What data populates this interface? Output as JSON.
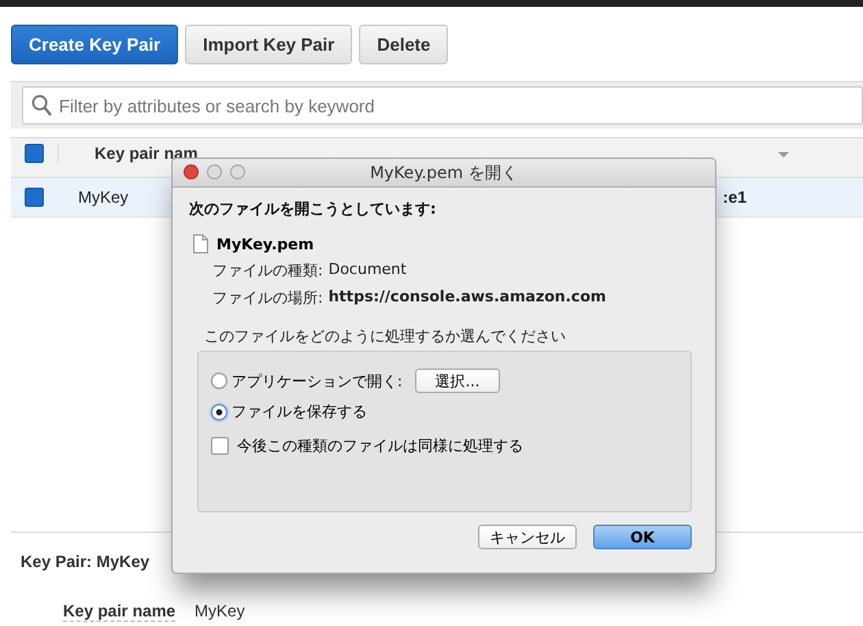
{
  "toolbar": {
    "buttons": [
      {
        "label": "Create Key Pair",
        "kind": "primary"
      },
      {
        "label": "Import Key Pair",
        "kind": "default"
      },
      {
        "label": "Delete",
        "kind": "default"
      }
    ]
  },
  "search": {
    "placeholder": "Filter by attributes or search by keyword"
  },
  "table": {
    "header_checked": true,
    "columns": [
      "Key pair nam"
    ],
    "rows": [
      {
        "checked": true,
        "selected": true,
        "cells": [
          "MyKey",
          ":e1"
        ]
      }
    ]
  },
  "details": {
    "title": "Key Pair: MyKey",
    "fields": [
      {
        "label": "Key pair name",
        "value": "MyKey"
      }
    ]
  },
  "dialog": {
    "title": "MyKey.pem を開く",
    "heading": "次のファイルを開こうとしています:",
    "file_name": "MyKey.pem",
    "info": [
      {
        "label": "ファイルの種類:",
        "value": "Document",
        "bold": false
      },
      {
        "label": "ファイルの場所:",
        "value": "https://console.aws.amazon.com",
        "bold": true
      }
    ],
    "question": "このファイルをどのように処理するか選んでください",
    "options": [
      {
        "label": "アプリケーションで開く:",
        "selected": false,
        "button": "選択..."
      },
      {
        "label": "ファイルを保存する",
        "selected": true
      }
    ],
    "remember": {
      "label": "今後この種類のファイルは同様に処理する",
      "checked": false
    },
    "buttons": [
      {
        "label": "キャンセル",
        "kind": "default"
      },
      {
        "label": "OK",
        "kind": "primary"
      }
    ]
  }
}
